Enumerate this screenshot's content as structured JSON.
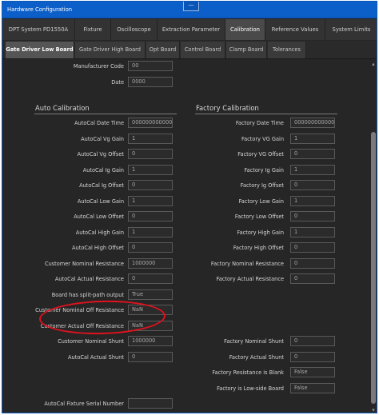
{
  "window": {
    "title": "Hardware Configuration",
    "handle": "—"
  },
  "main_tabs": [
    "DPT System PD1550A",
    "Fixture",
    "Oscilloscope",
    "Extraction Parameter",
    "Calibration",
    "Reference Values",
    "System Limits"
  ],
  "sub_tabs": [
    "Gate Driver Low Board",
    "Gate Driver High Board",
    "Opt Board",
    "Control Board",
    "Clamp Board",
    "Tolerances"
  ],
  "top_fields": [
    {
      "label": "Manufacturer Code",
      "value": "00"
    },
    {
      "label": "Date",
      "value": "0000"
    }
  ],
  "auto_calibration": {
    "title": "Auto Calibration",
    "rows": [
      {
        "label": "AutoCal Date Time",
        "value": "000000000000"
      },
      {
        "label": "AutoCal Vg Gain",
        "value": "1"
      },
      {
        "label": "AutoCal Vg Offset",
        "value": "0"
      },
      {
        "label": "AutoCal Ig Gain",
        "value": "1"
      },
      {
        "label": "AutoCal Ig Offset",
        "value": "0"
      },
      {
        "label": "AutoCal Low Gain",
        "value": "1"
      },
      {
        "label": "AutoCal Low Offset",
        "value": "0"
      },
      {
        "label": "AutoCal High Gain",
        "value": "1"
      },
      {
        "label": "AutoCal High Offset",
        "value": "0"
      },
      {
        "label": "Customer Nominal Resistance",
        "value": "1000000"
      },
      {
        "label": "AutoCal Actual Resistance",
        "value": "0"
      },
      {
        "label": "Board has split-path output",
        "value": "True"
      },
      {
        "label": "Customer Nominal Off Resistance",
        "value": "NaN"
      },
      {
        "label": "Customer Actual Off Resistance",
        "value": "NaN"
      },
      {
        "label": "Customer Nominal Shunt",
        "value": "1000000"
      },
      {
        "label": "AutoCal Actual Shunt",
        "value": "0"
      }
    ]
  },
  "factory_calibration": {
    "title": "Factory Calibration",
    "rows": [
      {
        "label": "Factory Date Time",
        "value": "000000000000"
      },
      {
        "label": "Factory VG Gain",
        "value": "1"
      },
      {
        "label": "Factory VG Offset",
        "value": "0"
      },
      {
        "label": "Factory Ig Gain",
        "value": "1"
      },
      {
        "label": "Factory Ig Offset",
        "value": "0"
      },
      {
        "label": "Factory Low Gain",
        "value": "1"
      },
      {
        "label": "Factory Low Offset",
        "value": "0"
      },
      {
        "label": "Factory High Gain",
        "value": "1"
      },
      {
        "label": "Factory High Offset",
        "value": "0"
      },
      {
        "label": "Factory Nominal Resistance",
        "value": "0"
      },
      {
        "label": "Factory Actual Resistance",
        "value": "0"
      }
    ],
    "lower_rows": [
      {
        "label": "Factory Nominal Shunt",
        "value": "0"
      },
      {
        "label": "Factory Actual Shunt",
        "value": "0"
      },
      {
        "label": "Factory Resistance is Blank",
        "value": "False"
      },
      {
        "label": "Factory is Low-side Board",
        "value": "False"
      }
    ]
  },
  "fixture_serial": {
    "label": "AutoCal Fixture Serial Number",
    "value": ""
  },
  "scroll": {
    "up": "▴",
    "down": "▾"
  },
  "colors": {
    "titlebar": "#0c5fc8",
    "highlight_ring": "#e0121e",
    "panel_bg": "#262626"
  }
}
